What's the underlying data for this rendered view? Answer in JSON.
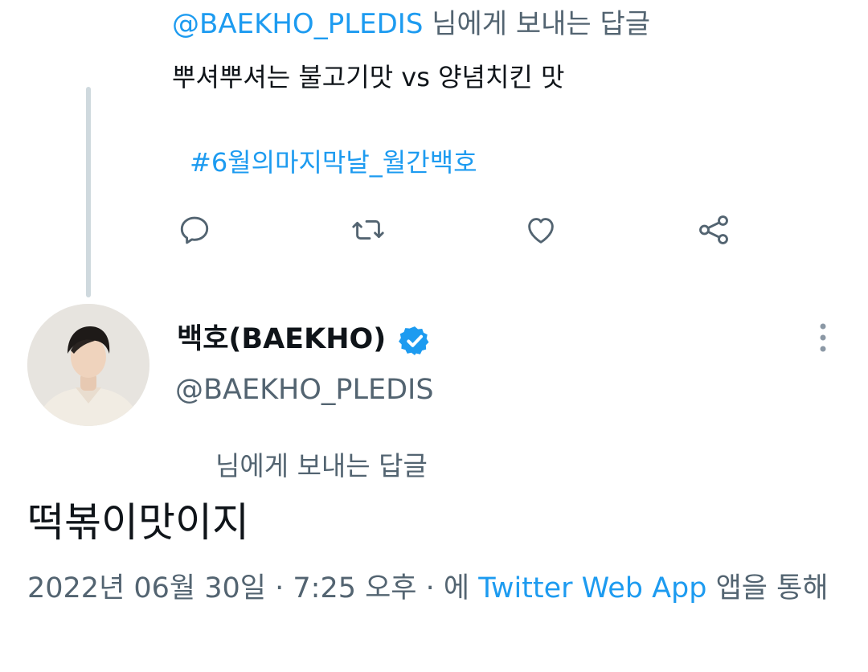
{
  "parent_tweet": {
    "reply_handle": "@BAEKHO_PLEDIS",
    "reply_suffix": " 님에게 보내는 답글",
    "text": "뿌셔뿌셔는 불고기맛 vs 양념치킨 맛",
    "hashtag": "#6월의마지막날_월간백호",
    "actions": [
      {
        "name": "reply-icon"
      },
      {
        "name": "retweet-icon"
      },
      {
        "name": "like-icon"
      },
      {
        "name": "share-icon"
      }
    ]
  },
  "tweet": {
    "display_name": "백호(BAEKHO)",
    "verified_icon": "verified-badge-icon",
    "username": "@BAEKHO_PLEDIS",
    "more_icon": "more-vertical-icon",
    "replying_to": "님에게 보내는 답글",
    "text": "떡볶이맛이지",
    "date": "2022년 06월 30일",
    "separator": " · ",
    "time": "7:25 오후",
    "via_prefix": "에 ",
    "source": "Twitter Web App",
    "via_suffix": " 앱을 통해"
  },
  "colors": {
    "accent": "#1d9bf0",
    "secondary_text": "#536471",
    "primary_text": "#0f1419",
    "thread_line": "#cfd9de"
  }
}
